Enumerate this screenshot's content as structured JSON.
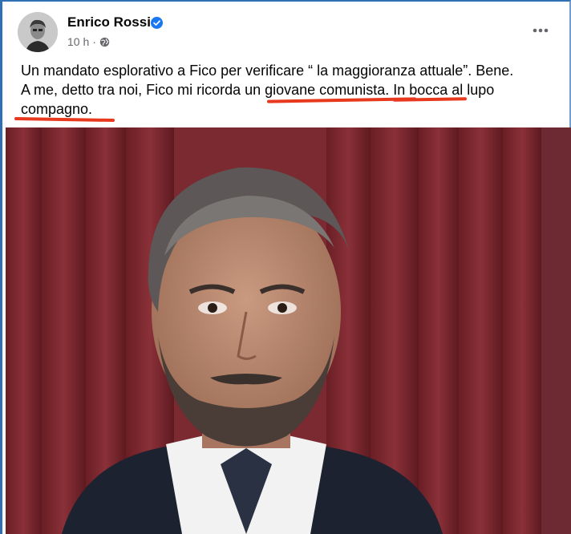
{
  "post": {
    "author": "Enrico Rossi",
    "time": "10 h",
    "separator": "·",
    "text_line1": "Un mandato esplorativo a Fico per verificare “ la maggioranza attuale”. Bene.",
    "text_line2": "A me, detto tra noi, Fico mi ricorda un giovane comunista. In bocca al lupo",
    "text_line3": "compagno."
  },
  "colors": {
    "underline": "#e8391f",
    "verified": "#1877f2",
    "curtain": "#7a2a30",
    "frame_border": "#2f6fb3"
  },
  "icons": {
    "verified": "verified-badge-icon",
    "globe": "globe-icon",
    "more": "more-options-icon"
  }
}
